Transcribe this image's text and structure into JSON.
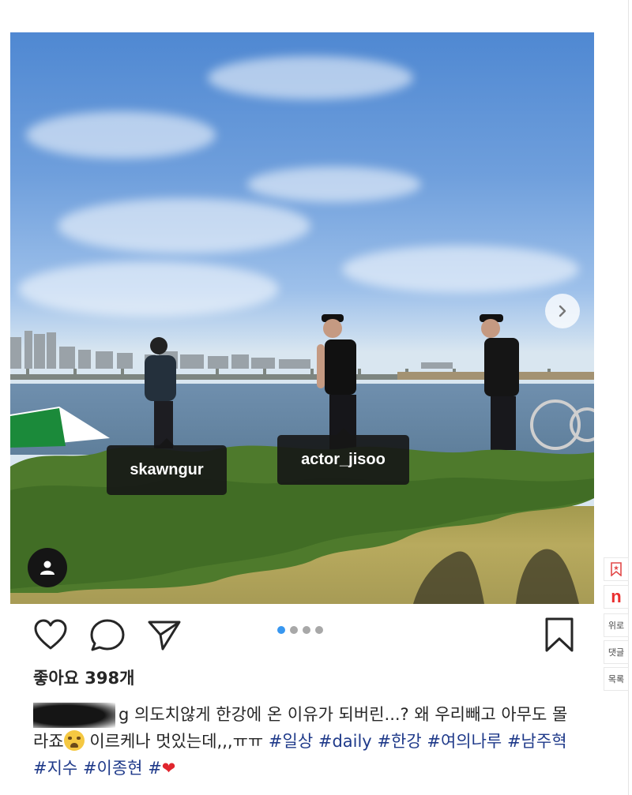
{
  "post": {
    "photo_tags": [
      "skawngur",
      "actor_jisoo"
    ],
    "carousel": {
      "total": 4,
      "active_index": 0
    },
    "likes_text": "좋아요 398개",
    "caption": {
      "username_tail": "g",
      "text_part1": " 의도치않게 한강에 온 이유가 되버린...? 왜 우리빼고 아무도 몰라죠",
      "text_part2": " 이르케나 멋있는데,,,ㅠㅠ ",
      "hashtags": [
        "#일상",
        "#daily",
        "#한강",
        "#여의나루",
        "#남주혁",
        "#지수",
        "#이종현",
        "#"
      ],
      "end_emoji": "❤"
    }
  },
  "icons": {
    "like": "heart-icon",
    "comment": "comment-bubble-icon",
    "share": "paper-plane-icon",
    "save": "bookmark-icon",
    "next": "chevron-right-icon",
    "user_tags": "person-icon"
  },
  "side_tools": {
    "bookmark_label": "",
    "naver_label": "n",
    "top_label": "위로",
    "comment_label": "댓글",
    "list_label": "목록"
  },
  "colors": {
    "accent_blue": "#3897f0",
    "hashtag": "#1f3a8a",
    "naver_red": "#ea2e2e"
  }
}
